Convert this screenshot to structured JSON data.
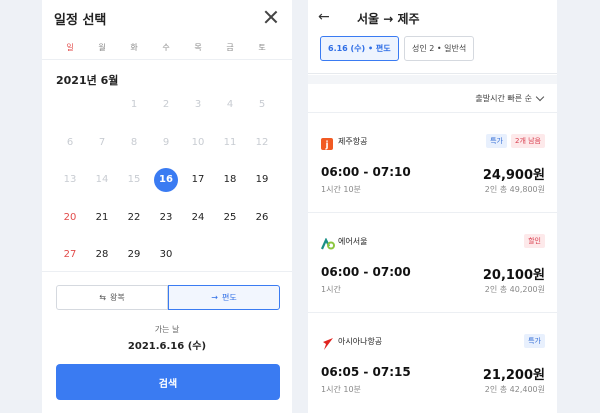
{
  "datepicker": {
    "title": "일정 선택",
    "weekdays": [
      "일",
      "월",
      "화",
      "수",
      "목",
      "금",
      "토"
    ],
    "month_label": "2021년 6월",
    "selected_day": 16,
    "trip_oneway_label": "편도",
    "trip_round_label": "왕복",
    "go_label": "가는 날",
    "go_date": "2021.6.16 (수)",
    "search_label": "검색"
  },
  "results": {
    "route": "서울 → 제주",
    "filter_date": "6.16 (수) • 편도",
    "filter_pax": "성인 2 • 일반석",
    "sort_label": "출발시간 빠른 순",
    "flights": [
      {
        "airline": "제주항공",
        "badges": [
          "특가",
          "2개 남음"
        ],
        "time": "06:00 - 07:10",
        "duration": "1시간 10분",
        "price": "24,900원",
        "total": "2인 총 49,800원",
        "logo_color": "#f15a23"
      },
      {
        "airline": "에어서울",
        "badges": [
          "할인"
        ],
        "time": "06:00 - 07:00",
        "duration": "1시간",
        "price": "20,100원",
        "total": "2인 총 40,200원",
        "logo_color": "#1a8f86"
      },
      {
        "airline": "아시아나항공",
        "badges": [
          "특가"
        ],
        "time": "06:05 - 07:15",
        "duration": "1시간 10분",
        "price": "21,200원",
        "total": "2인 총 42,400원",
        "logo_color": "#e0231f"
      }
    ]
  },
  "colors": {
    "accent": "#3a7bf2",
    "sunday": "#e24c4b"
  }
}
